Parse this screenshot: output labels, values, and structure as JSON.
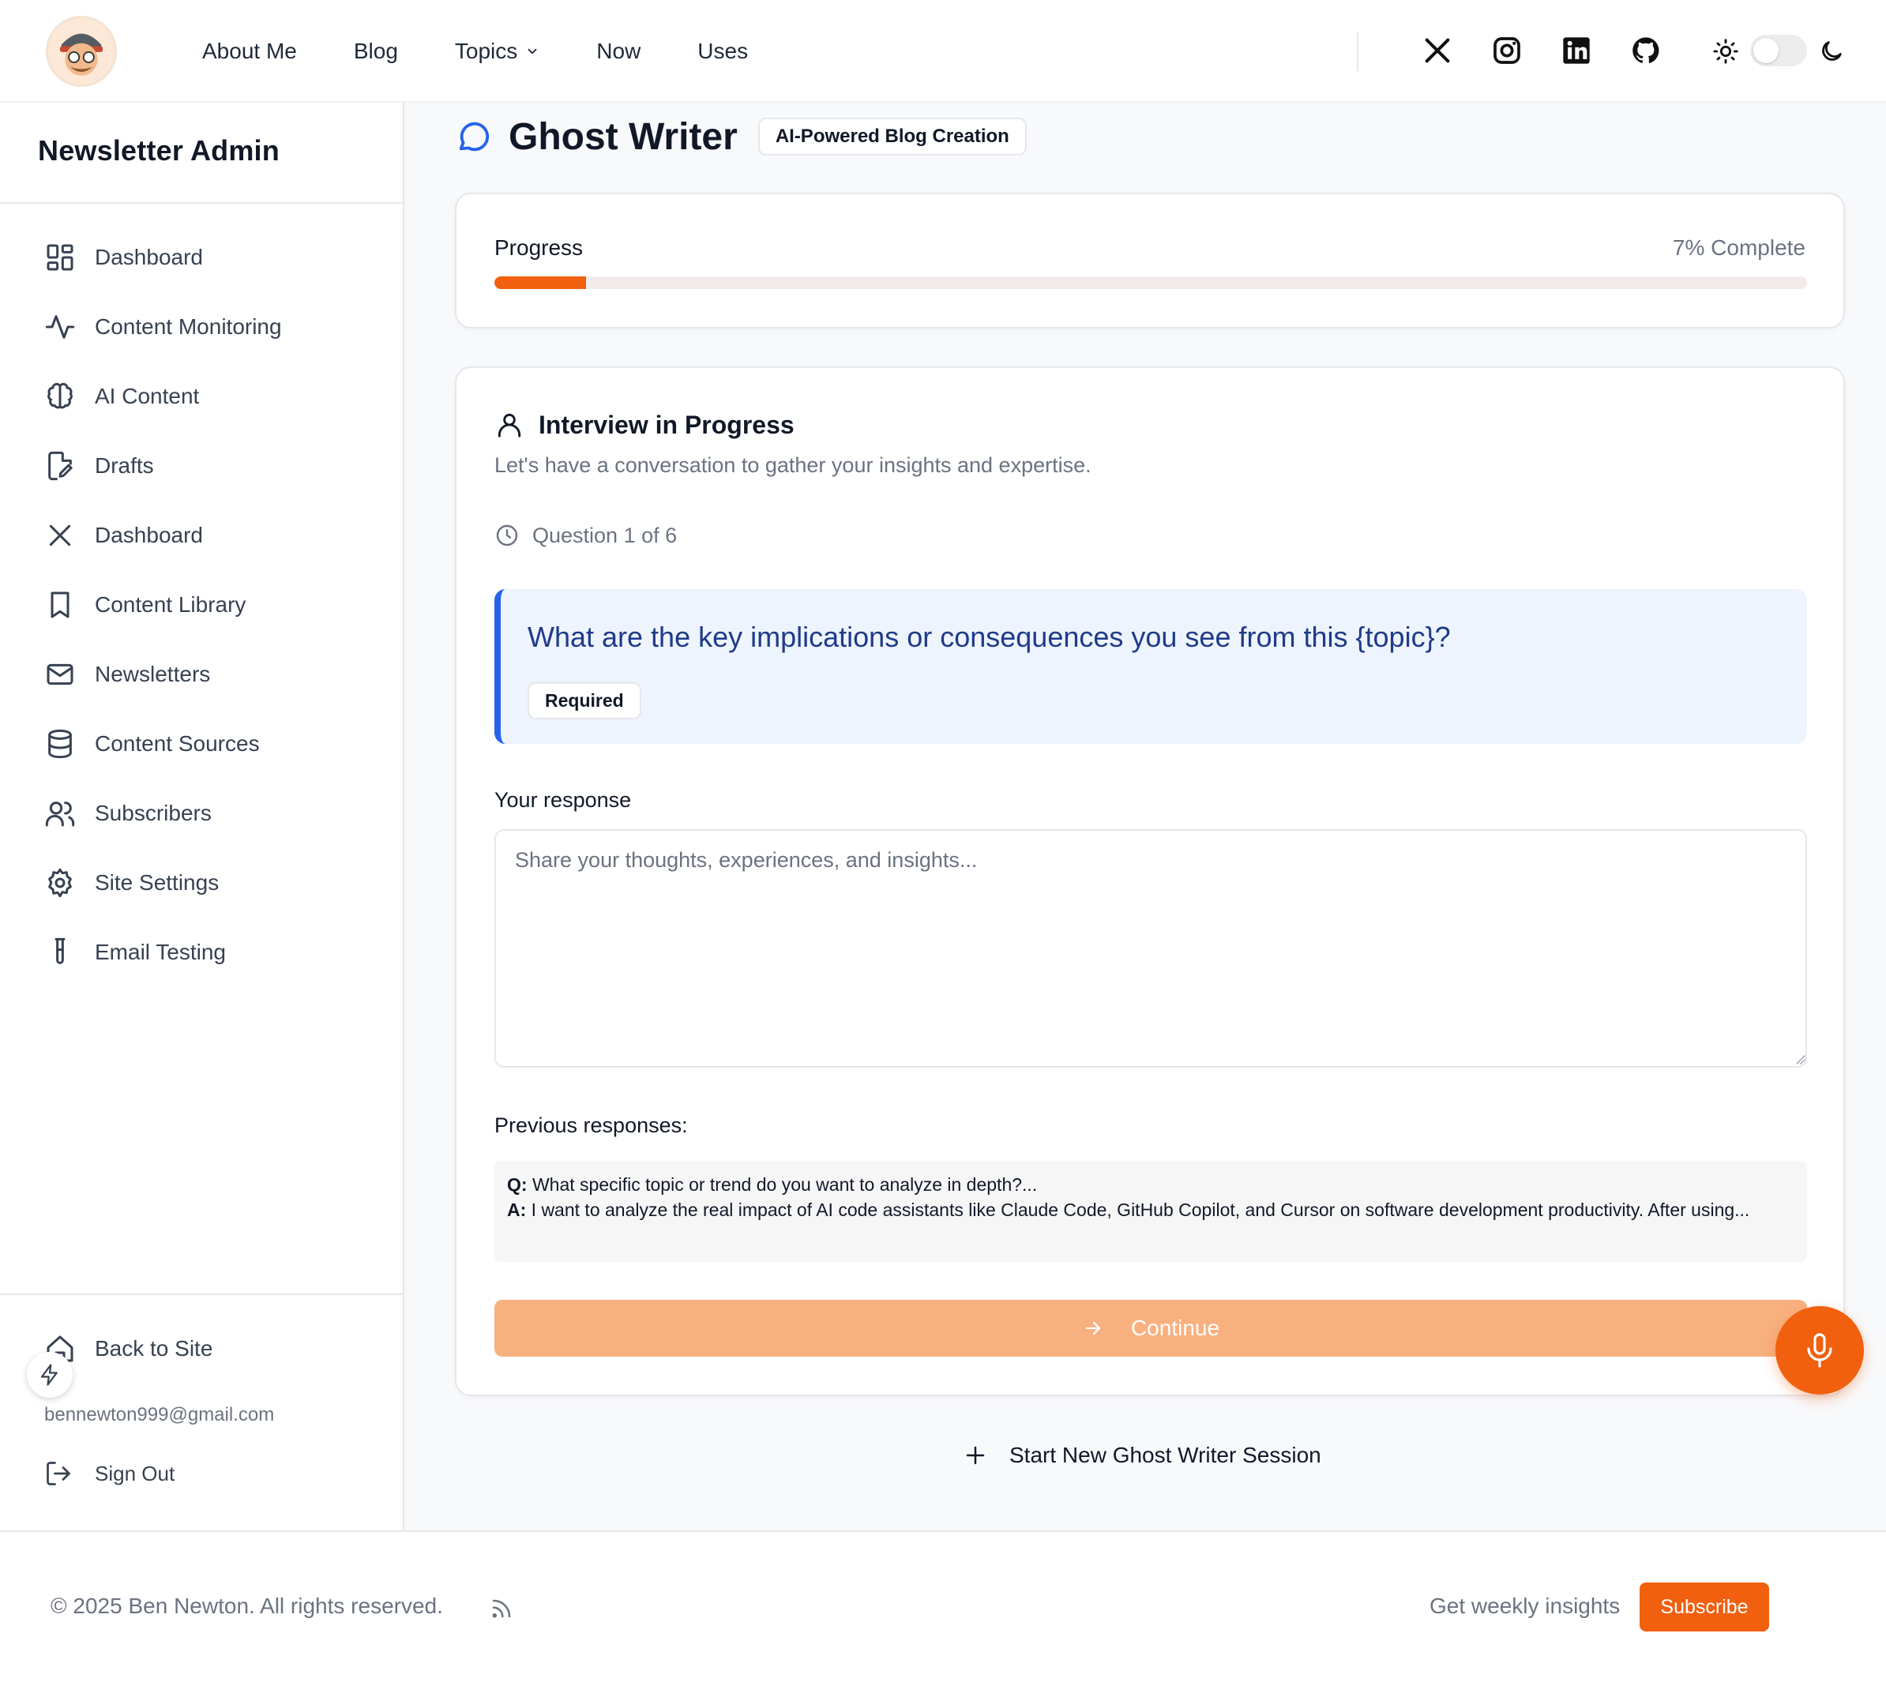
{
  "header": {
    "nav": [
      "About Me",
      "Blog",
      "Topics",
      "Now",
      "Uses"
    ],
    "social_icons": [
      "x-icon",
      "instagram-icon",
      "linkedin-icon",
      "github-icon"
    ],
    "theme": "light"
  },
  "sidebar": {
    "title": "Newsletter Admin",
    "items": [
      {
        "label": "Dashboard",
        "icon": "dashboard-icon"
      },
      {
        "label": "Content Monitoring",
        "icon": "activity-icon"
      },
      {
        "label": "AI Content",
        "icon": "brain-icon"
      },
      {
        "label": "Drafts",
        "icon": "file-edit-icon"
      },
      {
        "label": "Dashboard",
        "icon": "x-icon"
      },
      {
        "label": "Content Library",
        "icon": "bookmark-icon"
      },
      {
        "label": "Newsletters",
        "icon": "mail-icon"
      },
      {
        "label": "Content Sources",
        "icon": "database-icon"
      },
      {
        "label": "Subscribers",
        "icon": "users-icon"
      },
      {
        "label": "Site Settings",
        "icon": "gear-icon"
      },
      {
        "label": "Email Testing",
        "icon": "test-tube-icon"
      }
    ],
    "back_to_site": "Back to Site",
    "email": "bennewton999@gmail.com",
    "sign_out": "Sign Out"
  },
  "main": {
    "title": "Ghost Writer",
    "badge": "AI-Powered Blog Creation",
    "progress": {
      "label": "Progress",
      "percent_text": "7% Complete",
      "value": 0.07
    },
    "interview": {
      "heading": "Interview in Progress",
      "subtitle": "Let's have a conversation to gather your insights and expertise.",
      "question_number": "Question 1 of 6",
      "question": "What are the key implications or consequences you see from this {topic}?",
      "required_badge": "Required",
      "response_label": "Your response",
      "response_placeholder": "Share your thoughts, experiences, and insights...",
      "response_value": "",
      "previous_label": "Previous responses:",
      "previous": {
        "q_prefix": "Q:",
        "q_text": "What specific topic or trend do you want to analyze in depth?...",
        "a_prefix": "A:",
        "a_text": "I want to analyze the real impact of AI code assistants like Claude Code, GitHub Copilot, and Cursor on software development productivity. After using..."
      },
      "continue_label": "Continue"
    },
    "new_session": "Start New Ghost Writer Session"
  },
  "footer": {
    "copyright": "© 2025 Ben Newton. All rights reserved.",
    "weekly": "Get weekly insights",
    "subscribe": "Subscribe"
  },
  "colors": {
    "accent": "#f0600f",
    "accent_light": "#f9b07f",
    "question_bg": "#eef4fd",
    "question_border": "#2563eb",
    "question_text": "#1e3a8a"
  }
}
